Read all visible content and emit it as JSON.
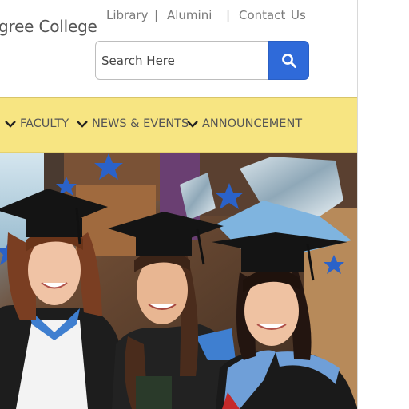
{
  "header": {
    "college_name": "gree College",
    "links": [
      {
        "label": "Library"
      },
      {
        "label": "Alumini"
      },
      {
        "label": "Contact"
      },
      {
        "label": "Us"
      }
    ],
    "separator": "|"
  },
  "search": {
    "placeholder": "Search Here",
    "button_icon": "search-icon"
  },
  "nav": {
    "items": [
      {
        "label": "FACULTY",
        "icon": "chevron-down-icon"
      },
      {
        "label": "NEWS & EVENTS",
        "icon": "chevron-down-icon"
      },
      {
        "label": "ANNOUNCEMENT",
        "icon": "chevron-down-icon"
      }
    ]
  },
  "hero": {
    "image": "photo of three smiling graduates in caps and gowns with blue star balloons"
  },
  "colors": {
    "nav_bg": "#f7e582",
    "search_button": "#2f6ad9",
    "text_muted": "#7a7a7a"
  }
}
